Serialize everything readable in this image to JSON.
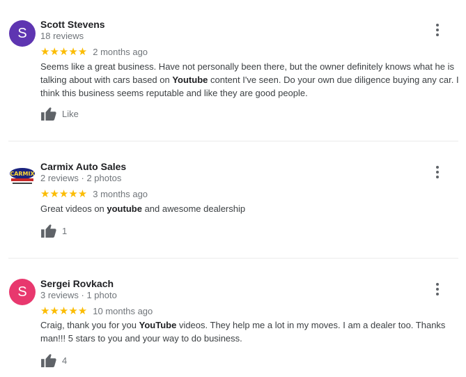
{
  "colors": {
    "star": "#fbbc04",
    "avatar_purple": "#5e35b1",
    "avatar_pink": "#e8386e",
    "text": "#3c4043",
    "muted": "#70757a"
  },
  "reviews": [
    {
      "avatar_letter": "S",
      "avatar_color": "#5e35b1",
      "name": "Scott Stevens",
      "meta": "18 reviews",
      "stars": "★★★★★",
      "when": "2 months ago",
      "text_segments": [
        "Seems like a great business. Have not personally been there, but the owner definitely knows what he is talking about with cars based on ",
        "Youtube",
        " content I've seen. Do your own due diligence buying any car. I think this business seems reputable and like they are good people."
      ],
      "like_label": "Like"
    },
    {
      "avatar_icon": "carmix-logo-icon",
      "name": "Carmix Auto Sales",
      "meta": "2 reviews · 2 photos",
      "stars": "★★★★★",
      "when": "3 months ago",
      "text_segments": [
        "Great videos on ",
        "youtube",
        " and awesome dealership"
      ],
      "like_label": "1"
    },
    {
      "avatar_letter": "S",
      "avatar_color": "#e8386e",
      "name": "Sergei Rovkach",
      "meta": "3 reviews · 1 photo",
      "stars": "★★★★★",
      "when": "10 months ago",
      "text_segments": [
        "Craig, thank you for you ",
        "YouTube",
        " videos. They help me a lot in my moves. I am a dealer too. Thanks man!!! 5 stars to you and your way to do business."
      ],
      "like_label": "4"
    }
  ],
  "logo_text": "CARMIX"
}
